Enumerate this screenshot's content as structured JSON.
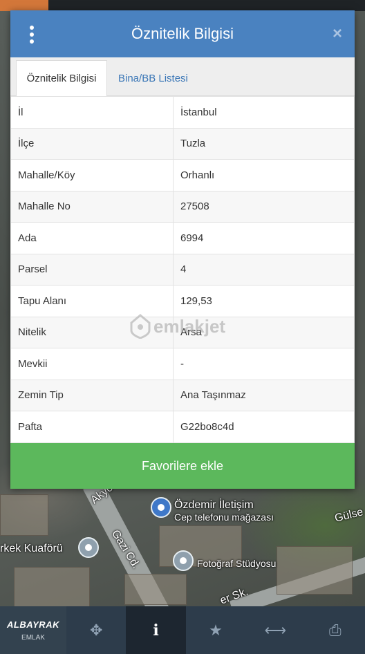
{
  "map": {
    "labels": {
      "akyol": "Akyo",
      "gazi": "Gazi Cd.",
      "ozdemir_title": "Özdemir İletişim",
      "ozdemir_sub": "Cep telefonu mağazası",
      "gulsen": "Gülse",
      "kuafor": "rkek Kuaförü",
      "fotograf": "Fotoğraf Stüdyosu",
      "street": "er Sk."
    }
  },
  "dialog": {
    "title": "Öznitelik Bilgisi",
    "close_label": "×",
    "tabs": [
      {
        "label": "Öznitelik Bilgisi",
        "active": true
      },
      {
        "label": "Bina/BB Listesi",
        "active": false
      }
    ],
    "rows": [
      {
        "key": "İl",
        "value": "İstanbul"
      },
      {
        "key": "İlçe",
        "value": "Tuzla"
      },
      {
        "key": "Mahalle/Köy",
        "value": "Orhanlı"
      },
      {
        "key": "Mahalle No",
        "value": "27508"
      },
      {
        "key": "Ada",
        "value": "6994"
      },
      {
        "key": "Parsel",
        "value": "4"
      },
      {
        "key": "Tapu Alanı",
        "value": "129,53"
      },
      {
        "key": "Nitelik",
        "value": "Arsa"
      },
      {
        "key": "Mevkii",
        "value": "-"
      },
      {
        "key": "Zemin Tip",
        "value": "Ana Taşınmaz"
      },
      {
        "key": "Pafta",
        "value": "G22bo8c4d"
      }
    ],
    "favorite_button": "Favorilere ekle"
  },
  "watermark": "emlakjet",
  "toolbar": {
    "logo_brand": "ALBAYRAK",
    "logo_sub": "EMLAK",
    "buttons": [
      {
        "icon": "move-arrows-icon",
        "glyph": "✥",
        "active": false
      },
      {
        "icon": "info-icon",
        "glyph": "i",
        "active": true
      },
      {
        "icon": "star-icon",
        "glyph": "★",
        "active": false
      },
      {
        "icon": "measure-icon",
        "glyph": "⟷",
        "active": false
      },
      {
        "icon": "printer-icon",
        "glyph": "⎙",
        "active": false
      }
    ]
  },
  "colors": {
    "header": "#4a82c0",
    "favorite": "#5cb85c",
    "toolbar": "#2d3c4b"
  }
}
